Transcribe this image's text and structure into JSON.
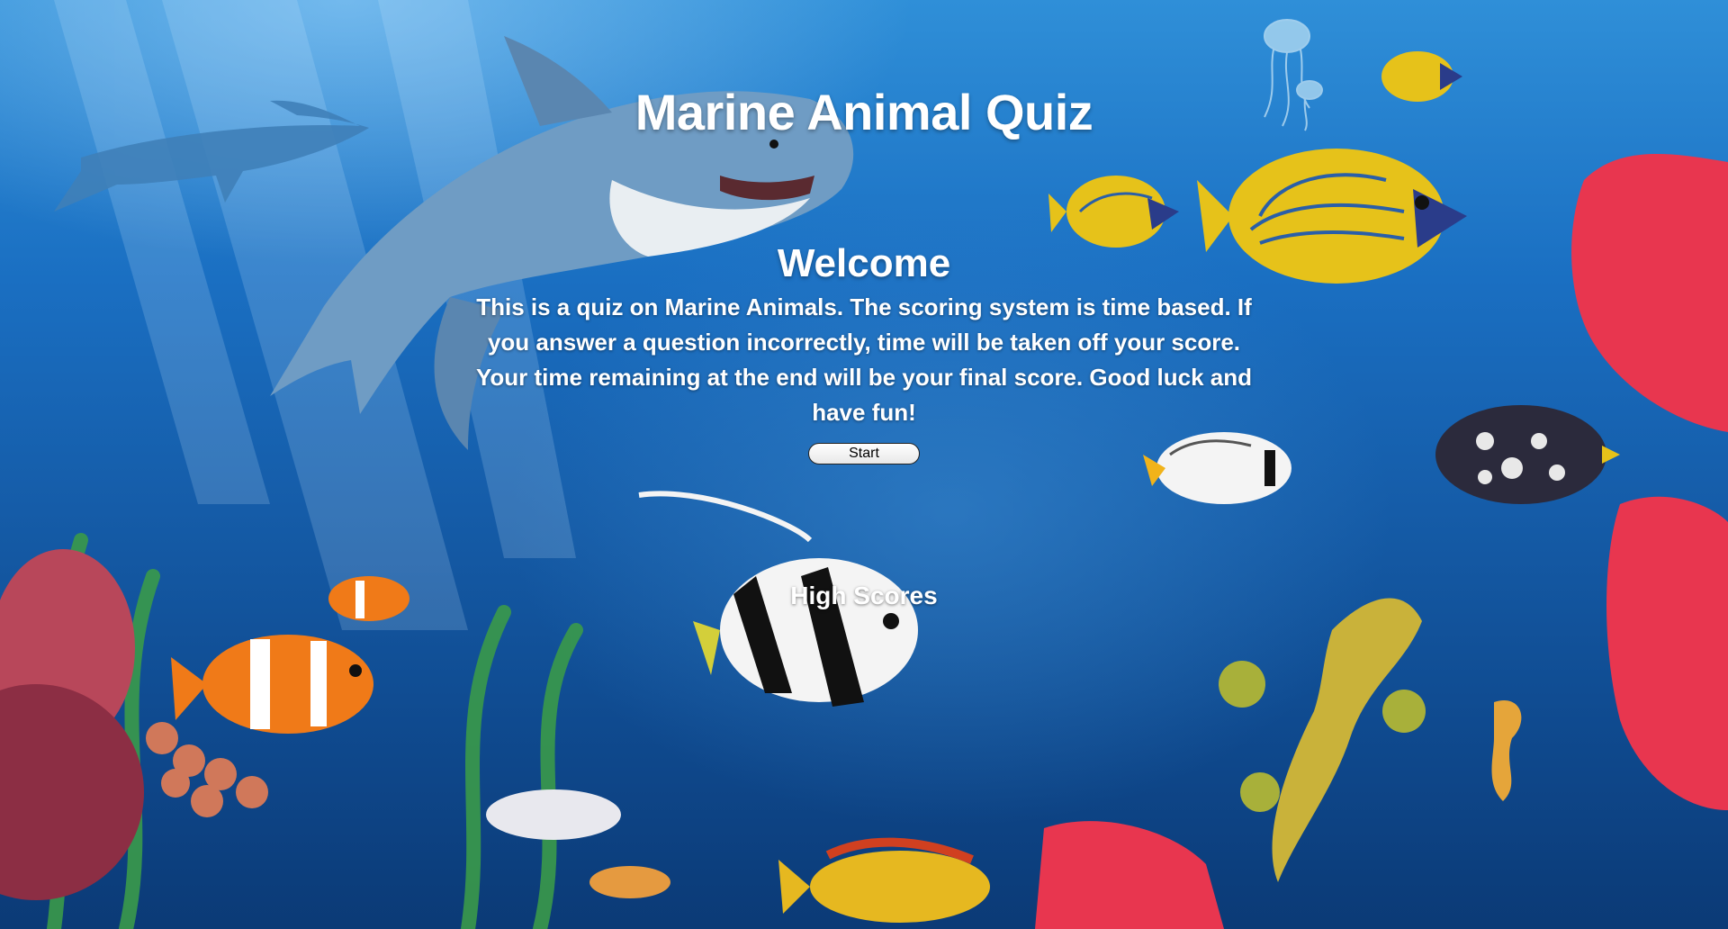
{
  "quiz": {
    "title": "Marine Animal Quiz",
    "welcome_heading": "Welcome",
    "intro_text": "This is a quiz on Marine Animals. The scoring system is time based. If you answer a question incorrectly, time will be taken off your score. Your time remaining at the end will be your final score. Good luck and have fun!",
    "start_label": "Start",
    "high_scores_label": "High Scores"
  },
  "colors": {
    "text": "#ffffff",
    "button_background": "#f0f0f0",
    "water_top": "#2f8fd8",
    "water_bottom": "#0b3a76"
  }
}
